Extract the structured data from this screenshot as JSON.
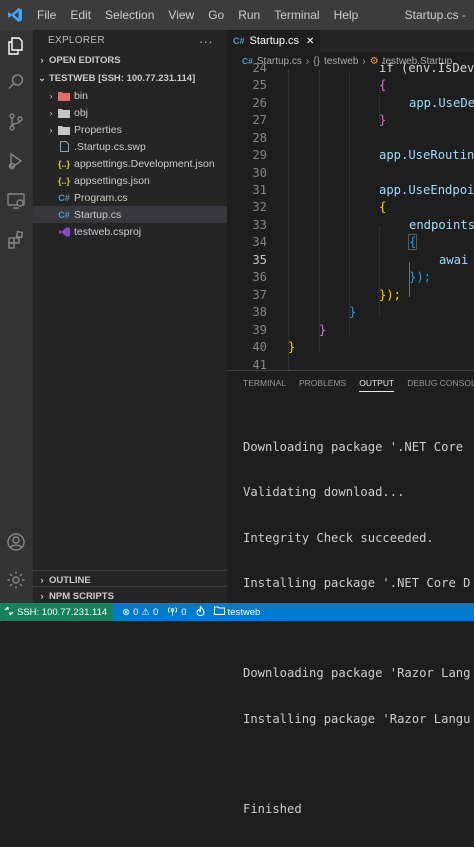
{
  "titlebar": {
    "menu": [
      "File",
      "Edit",
      "Selection",
      "View",
      "Go",
      "Run",
      "Terminal",
      "Help"
    ],
    "window_title": "Startup.cs -"
  },
  "sidebar": {
    "title": "EXPLORER",
    "more": "···",
    "open_editors": "OPEN EDITORS",
    "workspace": "TESTWEB [SSH: 100.77.231.114]",
    "files": [
      {
        "label": "bin",
        "type": "folder-bin"
      },
      {
        "label": "obj",
        "type": "folder"
      },
      {
        "label": "Properties",
        "type": "folder"
      },
      {
        "label": ".Startup.cs.swp",
        "type": "file"
      },
      {
        "label": "appsettings.Development.json",
        "type": "json"
      },
      {
        "label": "appsettings.json",
        "type": "json"
      },
      {
        "label": "Program.cs",
        "type": "cs"
      },
      {
        "label": "Startup.cs",
        "type": "cs",
        "selected": true
      },
      {
        "label": "testweb.csproj",
        "type": "csproj"
      }
    ],
    "outline": "OUTLINE",
    "npm_scripts": "NPM SCRIPTS"
  },
  "editor": {
    "tab": {
      "icon": "C#",
      "label": "Startup.cs",
      "close": "✕"
    },
    "breadcrumb": {
      "file_icon": "C#",
      "file": "Startup.cs",
      "ns_icon": "{}",
      "ns": "testweb",
      "class": "testweb.Startup"
    },
    "lines": [
      {
        "n": "24",
        "text": "if (env.IsDevelo"
      },
      {
        "n": "25",
        "text": "{"
      },
      {
        "n": "26",
        "text": "app.UseDe"
      },
      {
        "n": "27",
        "text": "}"
      },
      {
        "n": "28",
        "text": ""
      },
      {
        "n": "29",
        "text": "app.UseRoutin"
      },
      {
        "n": "30",
        "text": ""
      },
      {
        "n": "31",
        "text": "app.UseEndpoi"
      },
      {
        "n": "32",
        "text": "{"
      },
      {
        "n": "33",
        "text": "endpoints"
      },
      {
        "n": "34",
        "text": "{"
      },
      {
        "n": "35",
        "text": "awai"
      },
      {
        "n": "36",
        "text": "});"
      },
      {
        "n": "37",
        "text": "});"
      },
      {
        "n": "38",
        "text": "}"
      },
      {
        "n": "39",
        "text": "}"
      },
      {
        "n": "40",
        "text": "}"
      },
      {
        "n": "41",
        "text": ""
      }
    ],
    "current_line": "35"
  },
  "panel": {
    "tabs": [
      "TERMINAL",
      "PROBLEMS",
      "OUTPUT",
      "DEBUG CONSOLE"
    ],
    "active_tab": "OUTPUT",
    "output": [
      "Downloading package '.NET Core",
      "Validating download...",
      "Integrity Check succeeded.",
      "Installing package '.NET Core D",
      "",
      "Downloading package 'Razor Lang",
      "Installing package 'Razor Langu",
      "",
      "Finished"
    ]
  },
  "statusbar": {
    "remote": "SSH: 100.77.231.114",
    "errors": "0",
    "warnings": "0",
    "ports": "0",
    "project": "testweb"
  },
  "colors": {
    "accent": "#007acc",
    "remote": "#16825d",
    "csharp_icon": "#519aba",
    "json_icon": "#cbcb41",
    "csproj_icon": "#854cc7"
  }
}
